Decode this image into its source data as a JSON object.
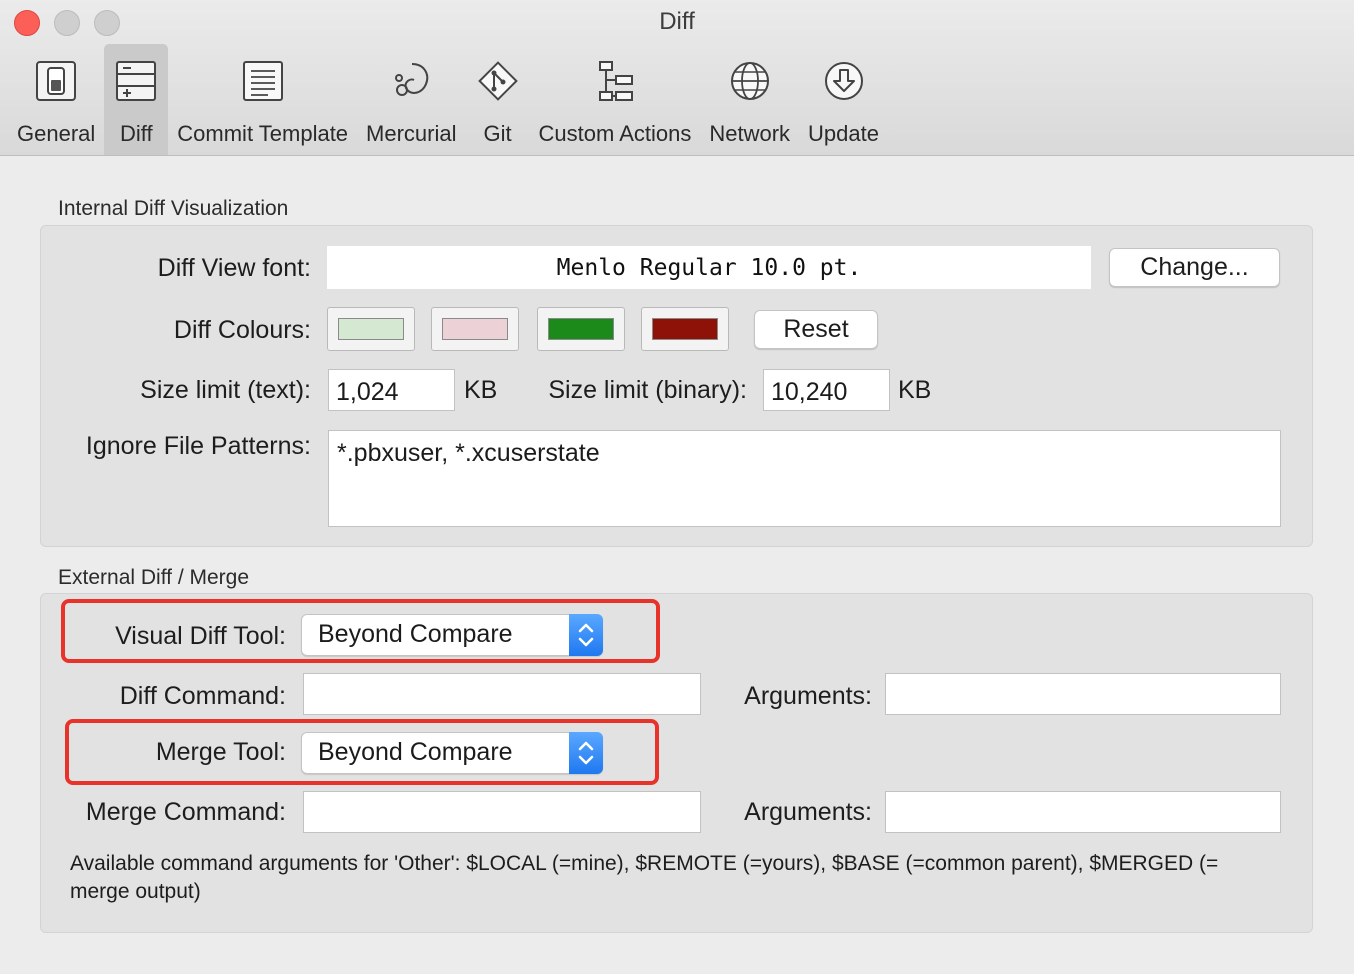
{
  "window": {
    "title": "Diff"
  },
  "toolbar": {
    "items": [
      {
        "label": "General",
        "icon": "general-switch-icon"
      },
      {
        "label": "Diff",
        "icon": "diff-panels-icon",
        "active": true
      },
      {
        "label": "Commit Template",
        "icon": "commit-template-icon"
      },
      {
        "label": "Mercurial",
        "icon": "mercurial-icon"
      },
      {
        "label": "Git",
        "icon": "git-icon"
      },
      {
        "label": "Custom Actions",
        "icon": "custom-actions-icon"
      },
      {
        "label": "Network",
        "icon": "globe-icon"
      },
      {
        "label": "Update",
        "icon": "update-download-icon"
      }
    ]
  },
  "internal": {
    "section_title": "Internal Diff Visualization",
    "font_label": "Diff View font:",
    "font_value": "Menlo Regular 10.0 pt.",
    "change_button": "Change...",
    "colours_label": "Diff Colours:",
    "colours": [
      "#d4e8d2",
      "#ecd2d6",
      "#1b8a1b",
      "#8f1208"
    ],
    "reset_button": "Reset",
    "size_text_label": "Size limit (text):",
    "size_text_value": "1,024",
    "size_text_unit": "KB",
    "size_binary_label": "Size limit (binary):",
    "size_binary_value": "10,240",
    "size_binary_unit": "KB",
    "ignore_label": "Ignore File Patterns:",
    "ignore_value": "*.pbxuser, *.xcuserstate"
  },
  "external": {
    "section_title": "External Diff / Merge",
    "visual_tool_label": "Visual Diff Tool:",
    "visual_tool_value": "Beyond Compare",
    "diff_command_label": "Diff Command:",
    "diff_command_value": "",
    "diff_arguments_label": "Arguments:",
    "diff_arguments_value": "",
    "merge_tool_label": "Merge Tool:",
    "merge_tool_value": "Beyond Compare",
    "merge_command_label": "Merge Command:",
    "merge_command_value": "",
    "merge_arguments_label": "Arguments:",
    "merge_arguments_value": "",
    "help_text": "Available command arguments for 'Other': $LOCAL (=mine), $REMOTE (=yours), $BASE (=common parent), $MERGED (= merge output)"
  },
  "colors": {
    "highlight": "#e8332a",
    "popup_accent": "#1f78f0"
  }
}
